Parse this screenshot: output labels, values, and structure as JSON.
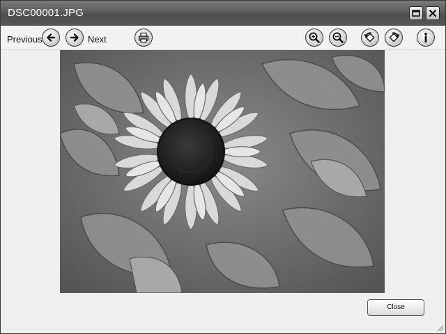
{
  "window": {
    "title": "DSC00001.JPG"
  },
  "title_buttons": {
    "restore_icon": "restore-icon",
    "close_icon": "close-icon"
  },
  "toolbar": {
    "previous_label": "Previous",
    "next_label": "Next",
    "icons": [
      "arrow-left-icon",
      "arrow-right-icon",
      "printer-icon",
      "zoom-in-icon",
      "zoom-out-icon",
      "rotate-left-icon",
      "rotate-right-icon",
      "info-icon"
    ]
  },
  "image": {
    "subject": "sunflower-photo"
  },
  "footer": {
    "close_label": "Close"
  },
  "colors": {
    "titlebar": "#5c5c5c",
    "window_bg": "#efefef"
  }
}
